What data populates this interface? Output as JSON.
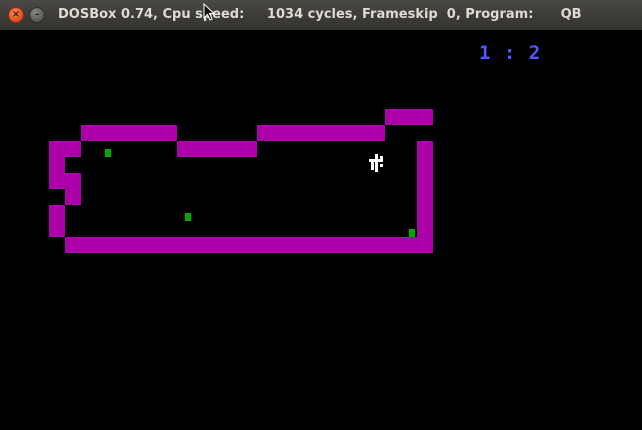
{
  "window": {
    "title": "DOSBox 0.74, Cpu speed:     1034 cycles, Frameskip  0, Program:      QB",
    "close_glyph": "×",
    "minimize_glyph": "–"
  },
  "game": {
    "score": "1 : 2",
    "colors": {
      "wall": "#aa00aa",
      "food": "#00aa00",
      "score": "#5555ff",
      "background": "#000000"
    },
    "player_icon": "little-figure-icon",
    "food_count": 3
  }
}
